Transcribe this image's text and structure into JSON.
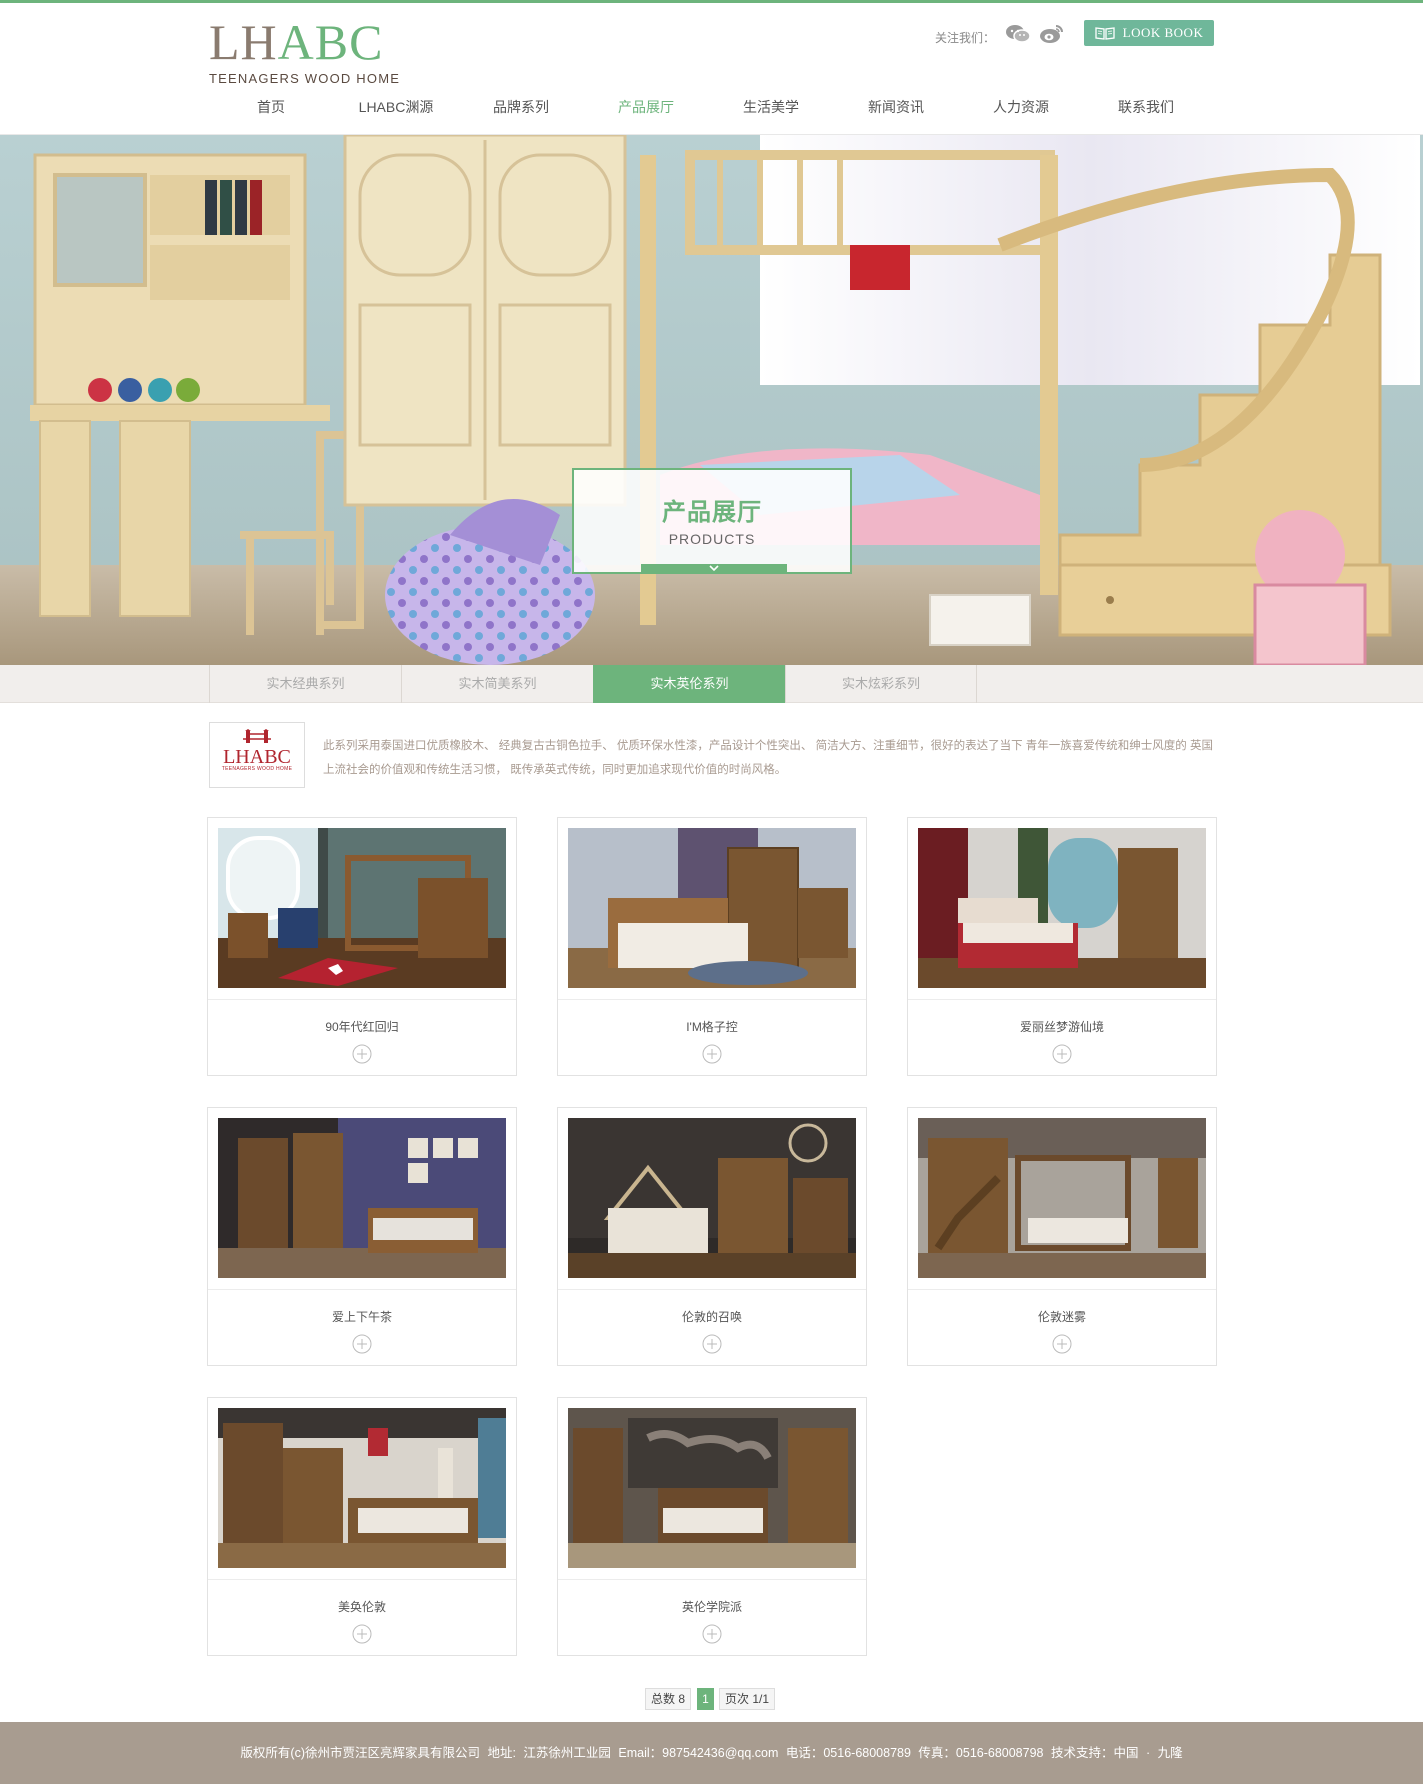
{
  "header": {
    "logo_main_left": "LH",
    "logo_main_right": "ABC",
    "logo_sub": "TEENAGERS WOOD HOME",
    "follow_label": "关注我们：",
    "social_icons": [
      "wechat-icon",
      "weibo-icon"
    ],
    "look_book_label": "LOOK BOOK",
    "look_book_icon": "book-icon"
  },
  "nav": {
    "items": [
      {
        "label": "首页"
      },
      {
        "label": "LHABC渊源"
      },
      {
        "label": "品牌系列"
      },
      {
        "label": "产品展厅"
      },
      {
        "label": "生活美学"
      },
      {
        "label": "新闻资讯"
      },
      {
        "label": "人力资源"
      },
      {
        "label": "联系我们"
      }
    ],
    "active_index": 3
  },
  "banner": {
    "title": "产品展厅",
    "subtitle": "PRODUCTS"
  },
  "series_tabs": {
    "items": [
      {
        "label": "实木经典系列"
      },
      {
        "label": "实木简美系列"
      },
      {
        "label": "实木英伦系列"
      },
      {
        "label": "实木炫彩系列"
      }
    ],
    "active_index": 2
  },
  "intro": {
    "logo_text": "LHABC",
    "logo_small": "TEENAGERS WOOD HOME",
    "text": "此系列采用泰国进口优质橡胶木、 经典复古古铜色拉手、 优质环保水性漆，产品设计个性突出、 简洁大方、注重细节，很好的表达了当下 青年一族喜爱传统和绅士风度的 英国上流社会的价值观和传统生活习惯， 既传承英式传统，同时更加追求现代价值的时尚风格。"
  },
  "products": [
    {
      "name": "90年代红回归"
    },
    {
      "name": "I'M格子控"
    },
    {
      "name": "爱丽丝梦游仙境"
    },
    {
      "name": "爱上下午茶"
    },
    {
      "name": "伦敦的召唤"
    },
    {
      "name": "伦敦迷雾"
    },
    {
      "name": "美奂伦敦"
    },
    {
      "name": "英伦学院派"
    }
  ],
  "pagination": {
    "total_label": "总数 8",
    "current_page": "1",
    "page_info": "页次 1/1"
  },
  "footer": {
    "text": "版权所有(c)徐州市贾汪区亮辉家具有限公司   地址: 江苏徐州工业园   Email：987542436@qq.com   电话：0516-68008789   传真：0516-68008798   技术支持：中国 · 九隆"
  },
  "colors": {
    "accent": "#6db47c",
    "footer_bg": "#a89c90",
    "tab_bg": "#f1eeec"
  }
}
